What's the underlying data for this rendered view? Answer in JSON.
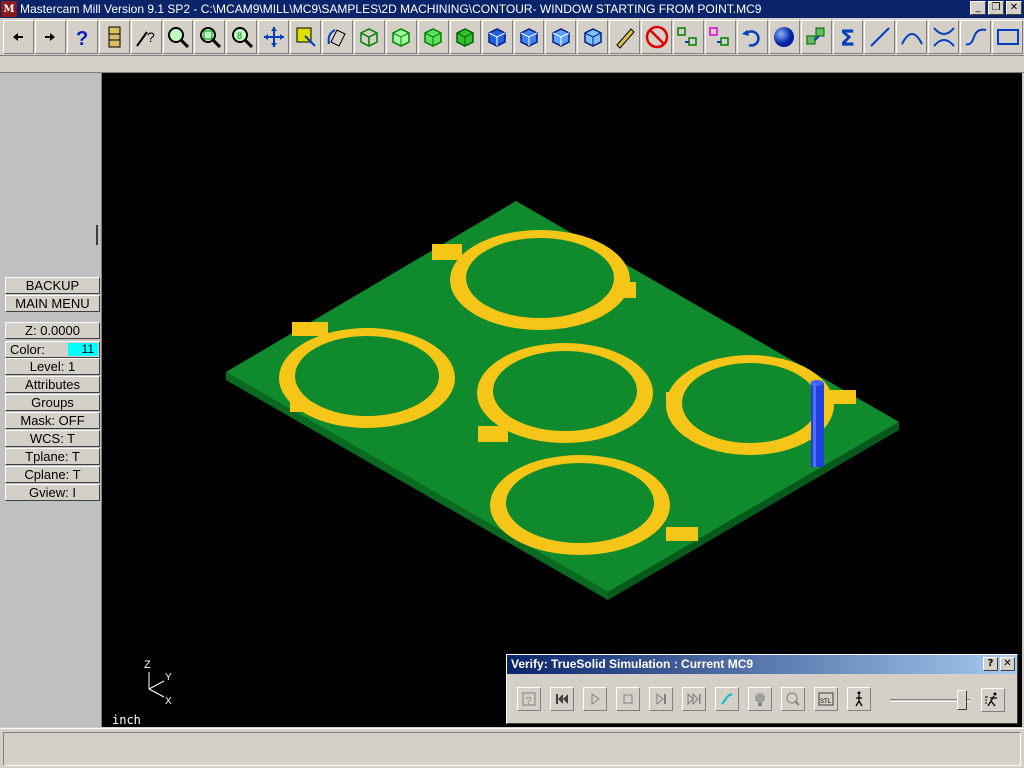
{
  "window": {
    "title": "Mastercam Mill Version 9.1 SP2 - C:\\MCAM9\\MILL\\MC9\\SAMPLES\\2D MACHINING\\CONTOUR- WINDOW STARTING FROM POINT.MC9",
    "app_icon_letter": "M",
    "controls": [
      "_",
      "❐",
      "✕"
    ]
  },
  "toolbar": {
    "icons": [
      "arrow-left-icon",
      "arrow-right-icon",
      "help-icon",
      "file-cabinet-icon",
      "analyze-icon",
      "query-icon",
      "zoom-window-icon",
      "zoom-out-icon",
      "zoom-dynamic-icon",
      "pan-icon",
      "screen-fit-icon",
      "rotate-icon",
      "cube-wire-icon",
      "cube-green1-icon",
      "cube-green2-icon",
      "cube-green3-icon",
      "cube-blue1-icon",
      "cube-blue2-icon",
      "cube-blue3-icon",
      "cube-blue4-icon",
      "pencil-icon",
      "no-delete-icon",
      "transform-icon",
      "transform-color-icon",
      "undo-icon",
      "sphere-icon",
      "group-icon",
      "sigma-icon",
      "line-icon",
      "arc-icon",
      "fillet-icon",
      "spline-icon",
      "rectangle-icon"
    ]
  },
  "left_menu": {
    "backup": "BACKUP",
    "main_menu": "MAIN MENU",
    "z": "Z:  0.0000",
    "color_label": "Color:",
    "color_value": "11",
    "level": "Level:  1",
    "attributes": "Attributes",
    "groups": "Groups",
    "mask": "Mask:  OFF",
    "wcs": "WCS:   T",
    "tplane": "Tplane:  T",
    "cplane": "Cplane:  T",
    "gview": "Gview:   I"
  },
  "viewport": {
    "units": "inch",
    "axes": {
      "z": "Z",
      "y": "Y",
      "x": "X"
    }
  },
  "verify": {
    "title": "Verify: TrueSolid Simulation : Current MC9",
    "help": "?",
    "close": "✕",
    "tools": [
      "options-icon",
      "rewind-icon",
      "play-icon",
      "stop-icon",
      "step-icon",
      "fast-forward-icon",
      "tool-display-icon",
      "light-icon",
      "zoom-part-icon",
      "stl-save-icon",
      "walk-icon",
      "run-icon"
    ],
    "speed_position": 0.95
  },
  "colors": {
    "stock": "#0f8a2c",
    "stock_side": "#0a5e1e",
    "pocket_wall": "#f5c518",
    "tool": "#2040e0",
    "cyan": "#00ffff"
  }
}
